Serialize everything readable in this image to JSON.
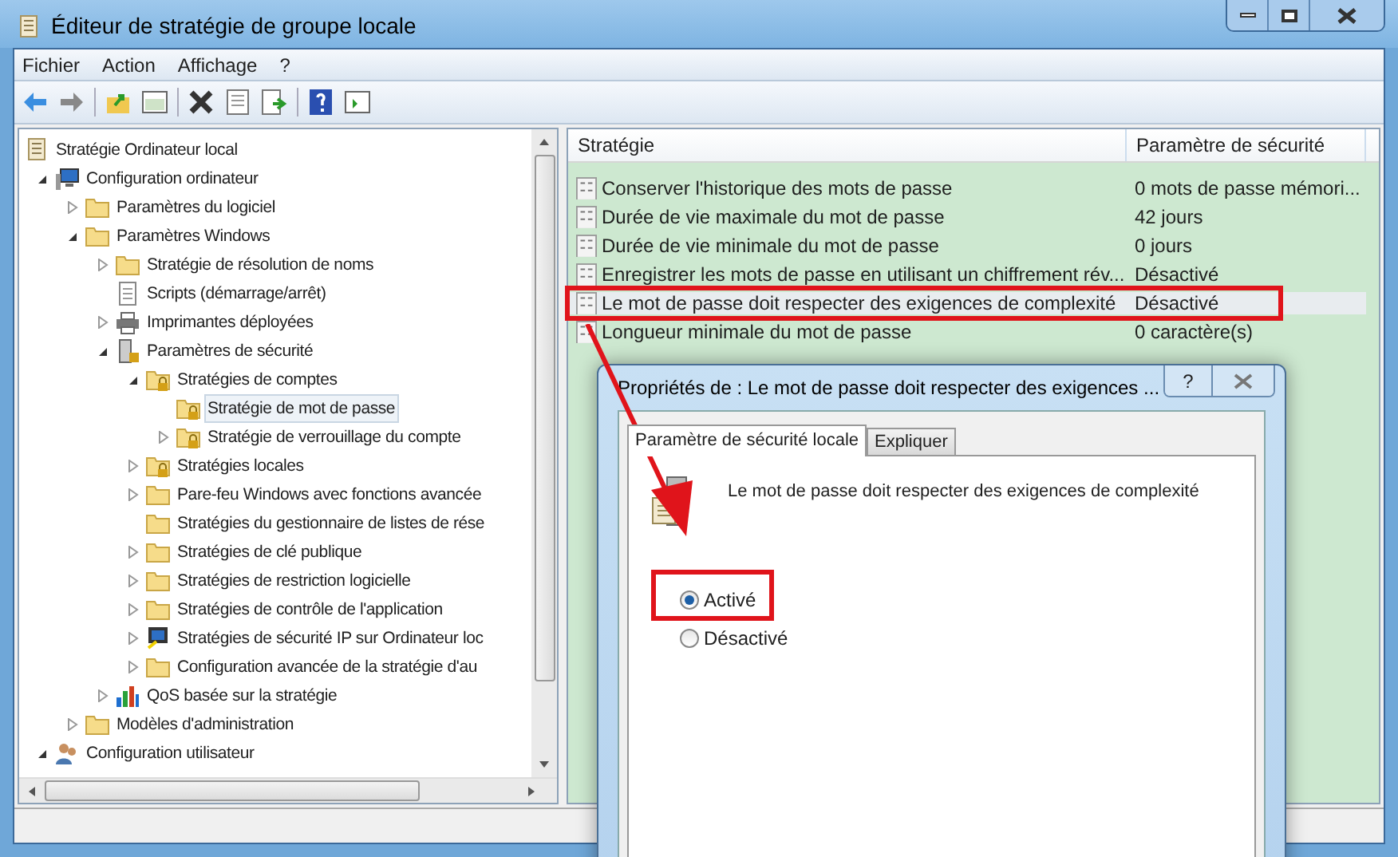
{
  "window": {
    "title": "Éditeur de stratégie de groupe locale"
  },
  "menu": [
    "Fichier",
    "Action",
    "Affichage",
    "?"
  ],
  "tree": [
    {
      "label": "Stratégie Ordinateur local",
      "kind": "scroll",
      "selected": false,
      "children": [
        {
          "label": "Configuration ordinateur",
          "kind": "computer",
          "expanded": true,
          "selected": false,
          "children": [
            {
              "label": "Paramètres du logiciel",
              "kind": "folder",
              "expanded": false,
              "selected": false
            },
            {
              "label": "Paramètres Windows",
              "kind": "folder",
              "expanded": true,
              "selected": false,
              "children": [
                {
                  "label": "Stratégie de résolution de noms",
                  "kind": "folder",
                  "expanded": false,
                  "selected": false
                },
                {
                  "label": "Scripts (démarrage/arrêt)",
                  "kind": "script",
                  "selected": false
                },
                {
                  "label": "Imprimantes déployées",
                  "kind": "printer",
                  "expanded": false,
                  "selected": false
                },
                {
                  "label": "Paramètres de sécurité",
                  "kind": "server",
                  "expanded": true,
                  "selected": false,
                  "children": [
                    {
                      "label": "Stratégies de comptes",
                      "kind": "lockfolder",
                      "expanded": true,
                      "selected": false,
                      "children": [
                        {
                          "label": "Stratégie de mot de passe",
                          "kind": "lockfolder",
                          "selected": true
                        },
                        {
                          "label": "Stratégie de verrouillage du compte",
                          "kind": "lockfolder",
                          "expanded": false,
                          "selected": false
                        }
                      ]
                    },
                    {
                      "label": "Stratégies locales",
                      "kind": "lockfolder",
                      "expanded": false,
                      "selected": false
                    },
                    {
                      "label": "Pare-feu Windows avec fonctions avancée",
                      "kind": "folder",
                      "expanded": false,
                      "selected": false
                    },
                    {
                      "label": "Stratégies du gestionnaire de listes de rése",
                      "kind": "folder",
                      "selected": false
                    },
                    {
                      "label": "Stratégies de clé publique",
                      "kind": "folder",
                      "expanded": false,
                      "selected": false
                    },
                    {
                      "label": "Stratégies de restriction logicielle",
                      "kind": "folder",
                      "expanded": false,
                      "selected": false
                    },
                    {
                      "label": "Stratégies de contrôle de l'application",
                      "kind": "folder",
                      "expanded": false,
                      "selected": false
                    },
                    {
                      "label": "Stratégies de sécurité IP sur Ordinateur loc",
                      "kind": "monitor",
                      "expanded": false,
                      "selected": false
                    },
                    {
                      "label": "Configuration avancée de la stratégie d'au",
                      "kind": "folder",
                      "expanded": false,
                      "selected": false
                    }
                  ]
                },
                {
                  "label": "QoS basée sur la stratégie",
                  "kind": "chart",
                  "expanded": false,
                  "selected": false
                }
              ]
            },
            {
              "label": "Modèles d'administration",
              "kind": "folder",
              "expanded": false,
              "selected": false
            }
          ]
        },
        {
          "label": "Configuration utilisateur",
          "kind": "users",
          "expanded": true,
          "selected": false
        }
      ]
    }
  ],
  "table": {
    "columns": [
      "Stratégie",
      "Paramètre de sécurité"
    ],
    "rows": [
      {
        "name": "Conserver l'historique des mots de passe",
        "value": "0 mots de passe mémori...",
        "selected": false
      },
      {
        "name": "Durée de vie maximale du mot de passe",
        "value": "42 jours",
        "selected": false
      },
      {
        "name": "Durée de vie minimale du mot de passe",
        "value": "0 jours",
        "selected": false
      },
      {
        "name": "Enregistrer les mots de passe en utilisant un chiffrement rév...",
        "value": "Désactivé",
        "selected": false
      },
      {
        "name": "Le mot de passe doit respecter des exigences de complexité",
        "value": "Désactivé",
        "selected": true
      },
      {
        "name": "Longueur minimale du mot de passe",
        "value": "0 caractère(s)",
        "selected": false
      }
    ]
  },
  "dialog": {
    "title": "Propriétés de : Le mot de passe doit respecter des exigences ...",
    "help": "?",
    "tabs": [
      {
        "label": "Paramètre de sécurité locale",
        "selected": true
      },
      {
        "label": "Expliquer",
        "selected": false
      }
    ],
    "policy": "Le mot de passe doit respecter des exigences de complexité",
    "options": [
      {
        "label": "Activé",
        "selected": true
      },
      {
        "label": "Désactivé",
        "selected": false
      }
    ]
  }
}
